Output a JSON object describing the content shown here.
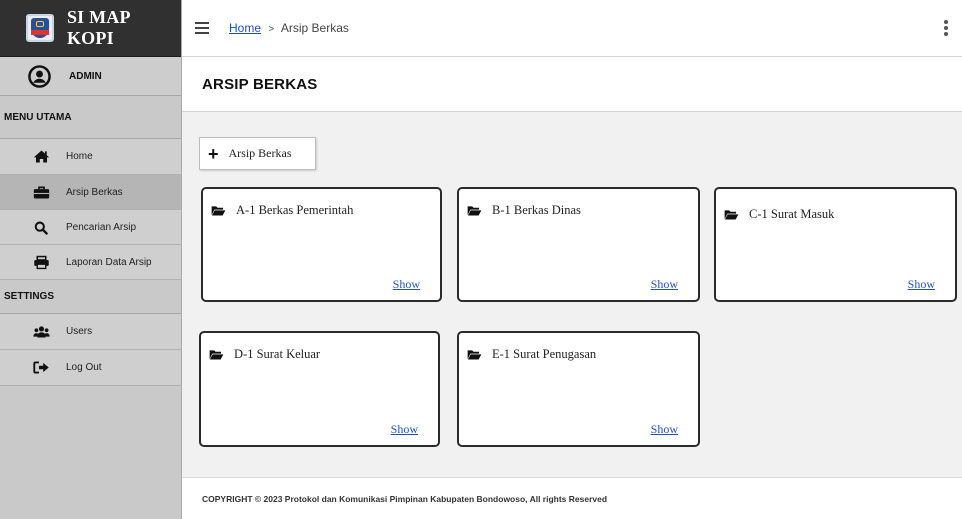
{
  "brand": {
    "title": "SI MAP KOPI",
    "logo_icon": "prokopim-logo"
  },
  "user": {
    "name": "ADMIN",
    "icon": "user-circle-icon"
  },
  "sidebar": {
    "section_main": "MENU UTAMA",
    "items": [
      {
        "label": "Home",
        "icon": "home-icon"
      },
      {
        "label": "Arsip Berkas",
        "icon": "briefcase-icon"
      },
      {
        "label": "Pencarian Arsip",
        "icon": "search-icon"
      },
      {
        "label": "Laporan Data Arsip",
        "icon": "print-icon"
      }
    ],
    "section_settings": "SETTINGS",
    "settings_items": [
      {
        "label": "Users",
        "icon": "users-icon"
      },
      {
        "label": "Log Out",
        "icon": "logout-icon"
      }
    ]
  },
  "header": {
    "breadcrumb_home": "Home",
    "breadcrumb_separator": ">",
    "breadcrumb_current": "Arsip Berkas"
  },
  "page": {
    "title": "ARSIP BERKAS"
  },
  "actions": {
    "add_label": "Arsip Berkas"
  },
  "folders": [
    {
      "name": "A-1 Berkas Pemerintah",
      "show": "Show"
    },
    {
      "name": "B-1 Berkas Dinas",
      "show": "Show"
    },
    {
      "name": "C-1 Surat Masuk",
      "show": "Show"
    },
    {
      "name": "D-1 Surat Keluar",
      "show": "Show"
    },
    {
      "name": "E-1 Surat Penugasan",
      "show": "Show"
    }
  ],
  "footer": {
    "text": "COPYRIGHT © 2023 Protokol dan Komunikasi Pimpinan Kabupaten Bondowoso, All rights Reserved"
  },
  "colors": {
    "sidebar_bg": "#c9c9c9",
    "brand_bg": "#303030",
    "link": "#2451b8",
    "content_bg": "#f1f1f1"
  }
}
